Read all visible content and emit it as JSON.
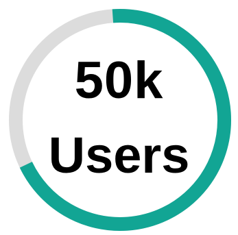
{
  "stat": {
    "value": "50k",
    "caption": "Users",
    "progress_percent": 69
  },
  "colors": {
    "progress": "#12a594",
    "track": "#dcdcdc",
    "text": "#000000",
    "background": "#ffffff"
  }
}
